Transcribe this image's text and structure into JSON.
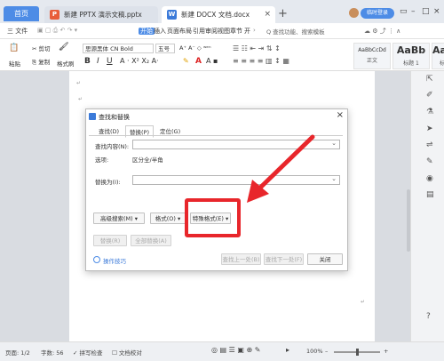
{
  "tabs": {
    "home": "首页",
    "doc1": "新建 PPTX 演示文稿.pptx",
    "doc2": "新建 DOCX 文档.docx"
  },
  "header": {
    "login": "临时登录"
  },
  "menu": {
    "file": "三 文件",
    "items": [
      "开始",
      "插入",
      "页面布局",
      "引用",
      "审阅",
      "视图",
      "章节",
      "开"
    ],
    "search": "Q 查找功能、搜索模板"
  },
  "ribbon": {
    "paste": "粘贴",
    "cut": "剪切",
    "copy": "复制",
    "format_painter": "格式刷",
    "font": "思源黑体 CN Bold",
    "size": "五号",
    "styles": [
      {
        "sample": "AaBbCcDd",
        "name": "正文"
      },
      {
        "sample": "AaBb",
        "name": "标题 1"
      },
      {
        "sample": "AaBb",
        "name": "标题"
      }
    ]
  },
  "dialog": {
    "title": "查找和替换",
    "tabs": [
      "查找(D)",
      "替换(P)",
      "定位(G)"
    ],
    "find_label": "查找内容(N):",
    "options_label": "选项:",
    "options_value": "区分全/半角",
    "replace_label": "替换为(I):",
    "buttons": {
      "advanced": "高级搜索(M) ▾",
      "format": "格式(O) ▾",
      "special": "特殊格式(E) ▾",
      "replace": "替换(R)",
      "replace_all": "全部替换(A)",
      "find_prev": "查找上一处(B)",
      "find_next": "查找下一处(F)",
      "close": "关闭"
    },
    "hint": "操作技巧"
  },
  "status": {
    "page": "页面: 1/2",
    "words": "字数: 56",
    "spell": "拼写检查",
    "proof": "文档校对",
    "zoom": "100%"
  },
  "colors": {
    "accent": "#4d8ce6",
    "highlight": "#e8262b"
  }
}
